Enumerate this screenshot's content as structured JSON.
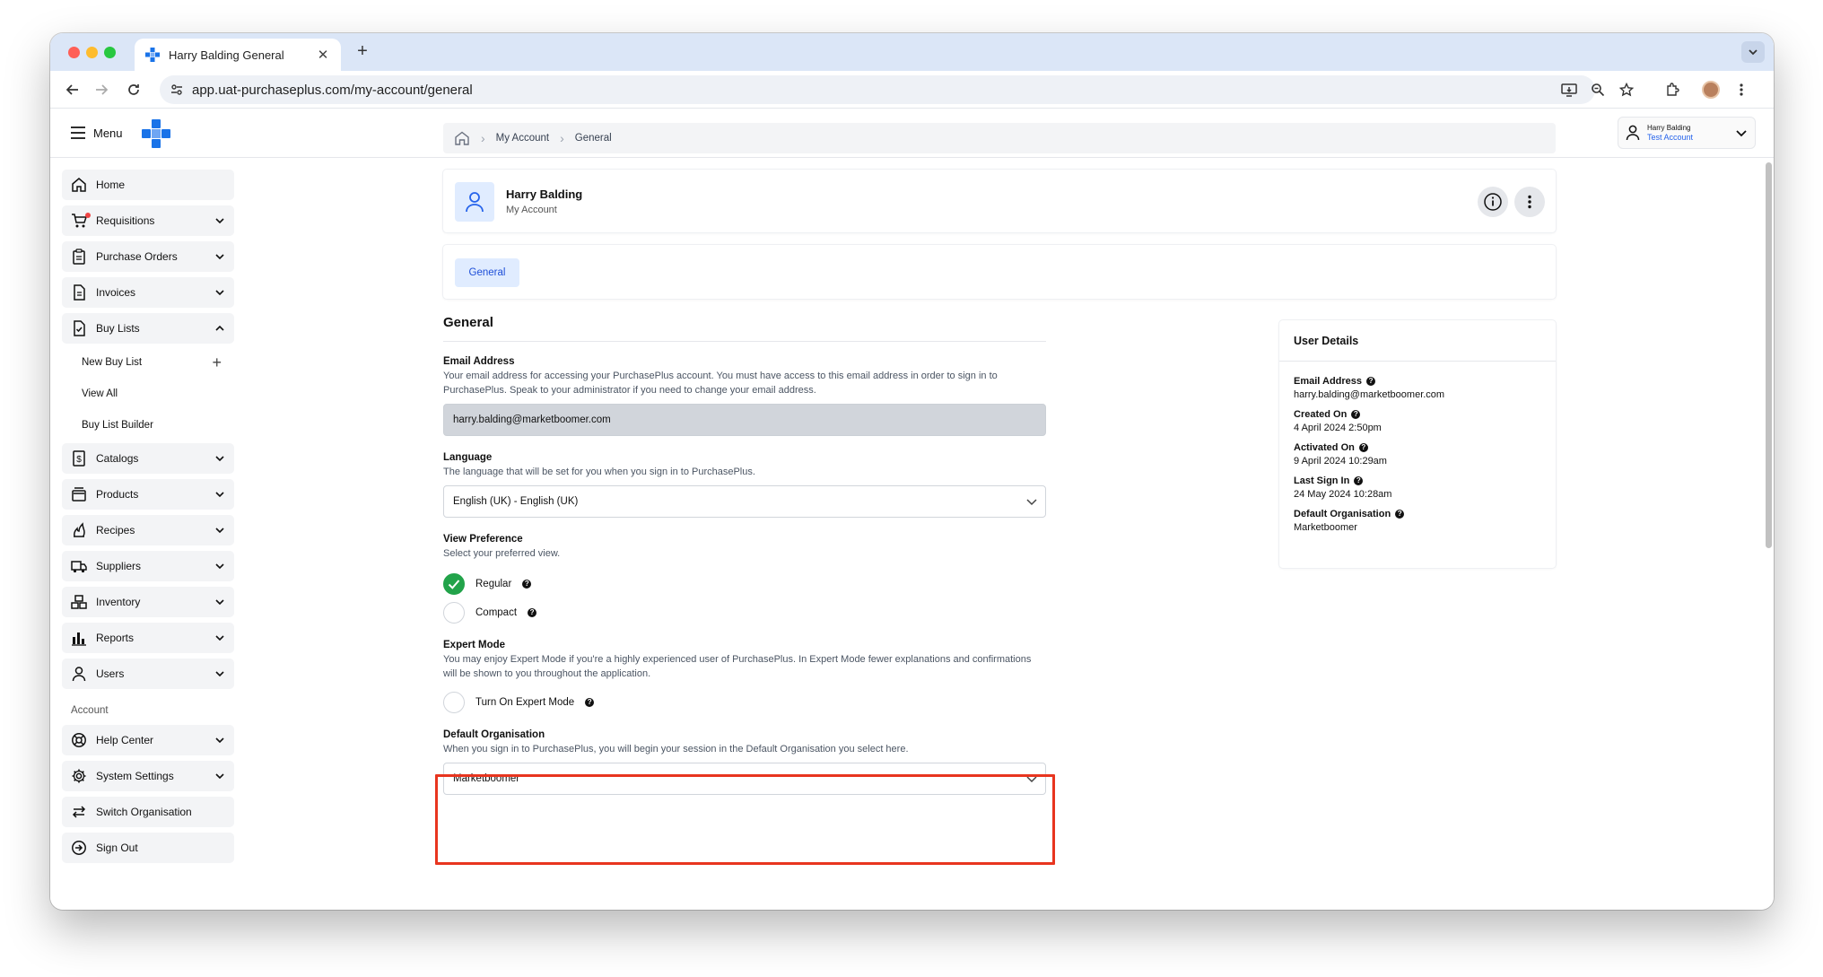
{
  "browser": {
    "tab_title": "Harry Balding General",
    "url": "app.uat-purchaseplus.com/my-account/general"
  },
  "header": {
    "menu_label": "Menu",
    "user_name": "Harry Balding",
    "user_account": "Test Account"
  },
  "sidebar": {
    "items": [
      {
        "label": "Home"
      },
      {
        "label": "Requisitions"
      },
      {
        "label": "Purchase Orders"
      },
      {
        "label": "Invoices"
      },
      {
        "label": "Buy Lists"
      },
      {
        "label": "Catalogs"
      },
      {
        "label": "Products"
      },
      {
        "label": "Recipes"
      },
      {
        "label": "Suppliers"
      },
      {
        "label": "Inventory"
      },
      {
        "label": "Reports"
      },
      {
        "label": "Users"
      }
    ],
    "buy_list_sub": [
      "New Buy List",
      "View All",
      "Buy List Builder"
    ],
    "account_section": "Account",
    "account_items": [
      {
        "label": "Help Center"
      },
      {
        "label": "System Settings"
      },
      {
        "label": "Switch Organisation"
      },
      {
        "label": "Sign Out"
      }
    ]
  },
  "breadcrumb": {
    "items": [
      "My Account",
      "General"
    ]
  },
  "profile": {
    "name": "Harry Balding",
    "subtitle": "My Account"
  },
  "tabs": {
    "general": "General"
  },
  "form": {
    "title": "General",
    "email": {
      "label": "Email Address",
      "desc": "Your email address for accessing your PurchasePlus account. You must have access to this email address in order to sign in to PurchasePlus. Speak to your administrator if you need to change your email address.",
      "value": "harry.balding@marketboomer.com"
    },
    "language": {
      "label": "Language",
      "desc": "The language that will be set for you when you sign in to PurchasePlus.",
      "value": "English (UK) - English (UK)"
    },
    "view_pref": {
      "label": "View Preference",
      "desc": "Select your preferred view.",
      "options": [
        "Regular",
        "Compact"
      ],
      "selected": "Regular"
    },
    "expert": {
      "label": "Expert Mode",
      "desc": "You may enjoy Expert Mode if you're a highly experienced user of PurchasePlus. In Expert Mode fewer explanations and confirmations will be shown to you throughout the application.",
      "option": "Turn On Expert Mode"
    },
    "default_org": {
      "label": "Default Organisation",
      "desc": "When you sign in to PurchasePlus, you will begin your session in the Default Organisation you select here.",
      "value": "Marketboomer"
    }
  },
  "details": {
    "title": "User Details",
    "rows": [
      {
        "label": "Email Address",
        "value": "harry.balding@marketboomer.com"
      },
      {
        "label": "Created On",
        "value": "4 April 2024 2:50pm"
      },
      {
        "label": "Activated On",
        "value": "9 April 2024 10:29am"
      },
      {
        "label": "Last Sign In",
        "value": "24 May 2024 10:28am"
      },
      {
        "label": "Default Organisation",
        "value": "Marketboomer"
      }
    ]
  },
  "colors": {
    "accent": "#2563eb",
    "selected_radio": "#22a34a",
    "highlight": "#e8351f"
  }
}
